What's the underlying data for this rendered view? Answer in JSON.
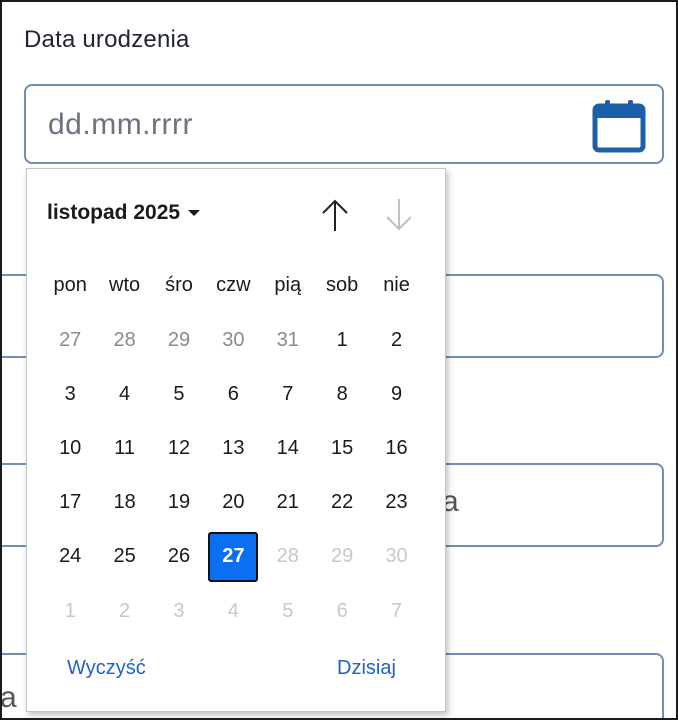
{
  "field": {
    "label": "Data urodzenia",
    "placeholder": "dd.mm.rrrr"
  },
  "background_fields": [
    {
      "text": ""
    },
    {
      "text": "a"
    },
    {
      "text": "a"
    }
  ],
  "calendar": {
    "month_label": "listopad 2025",
    "weekdays": [
      "pon",
      "wto",
      "śro",
      "czw",
      "pią",
      "sob",
      "nie"
    ],
    "days": [
      {
        "label": "27",
        "state": "other"
      },
      {
        "label": "28",
        "state": "other"
      },
      {
        "label": "29",
        "state": "other"
      },
      {
        "label": "30",
        "state": "other"
      },
      {
        "label": "31",
        "state": "other"
      },
      {
        "label": "1",
        "state": "current"
      },
      {
        "label": "2",
        "state": "current"
      },
      {
        "label": "3",
        "state": "current"
      },
      {
        "label": "4",
        "state": "current"
      },
      {
        "label": "5",
        "state": "current"
      },
      {
        "label": "6",
        "state": "current"
      },
      {
        "label": "7",
        "state": "current"
      },
      {
        "label": "8",
        "state": "current"
      },
      {
        "label": "9",
        "state": "current"
      },
      {
        "label": "10",
        "state": "current"
      },
      {
        "label": "11",
        "state": "current"
      },
      {
        "label": "12",
        "state": "current"
      },
      {
        "label": "13",
        "state": "current"
      },
      {
        "label": "14",
        "state": "current"
      },
      {
        "label": "15",
        "state": "current"
      },
      {
        "label": "16",
        "state": "current"
      },
      {
        "label": "17",
        "state": "current"
      },
      {
        "label": "18",
        "state": "current"
      },
      {
        "label": "19",
        "state": "current"
      },
      {
        "label": "20",
        "state": "current"
      },
      {
        "label": "21",
        "state": "current"
      },
      {
        "label": "22",
        "state": "current"
      },
      {
        "label": "23",
        "state": "current"
      },
      {
        "label": "24",
        "state": "current"
      },
      {
        "label": "25",
        "state": "current"
      },
      {
        "label": "26",
        "state": "current"
      },
      {
        "label": "27",
        "state": "selected"
      },
      {
        "label": "28",
        "state": "disabled"
      },
      {
        "label": "29",
        "state": "disabled"
      },
      {
        "label": "30",
        "state": "disabled"
      },
      {
        "label": "1",
        "state": "disabled"
      },
      {
        "label": "2",
        "state": "disabled"
      },
      {
        "label": "3",
        "state": "disabled"
      },
      {
        "label": "4",
        "state": "disabled"
      },
      {
        "label": "5",
        "state": "disabled"
      },
      {
        "label": "6",
        "state": "disabled"
      },
      {
        "label": "7",
        "state": "disabled"
      }
    ],
    "clear_label": "Wyczyść",
    "today_label": "Dzisiaj",
    "icons": {
      "input": "calendar-icon",
      "prev": "arrow-up-icon",
      "next": "arrow-down-icon",
      "month_dropdown": "caret-down-icon"
    }
  },
  "colors": {
    "accent": "#0a6ff0",
    "link": "#1f63c6",
    "input_border": "#6f8fb6",
    "icon": "#1d5fa8"
  }
}
